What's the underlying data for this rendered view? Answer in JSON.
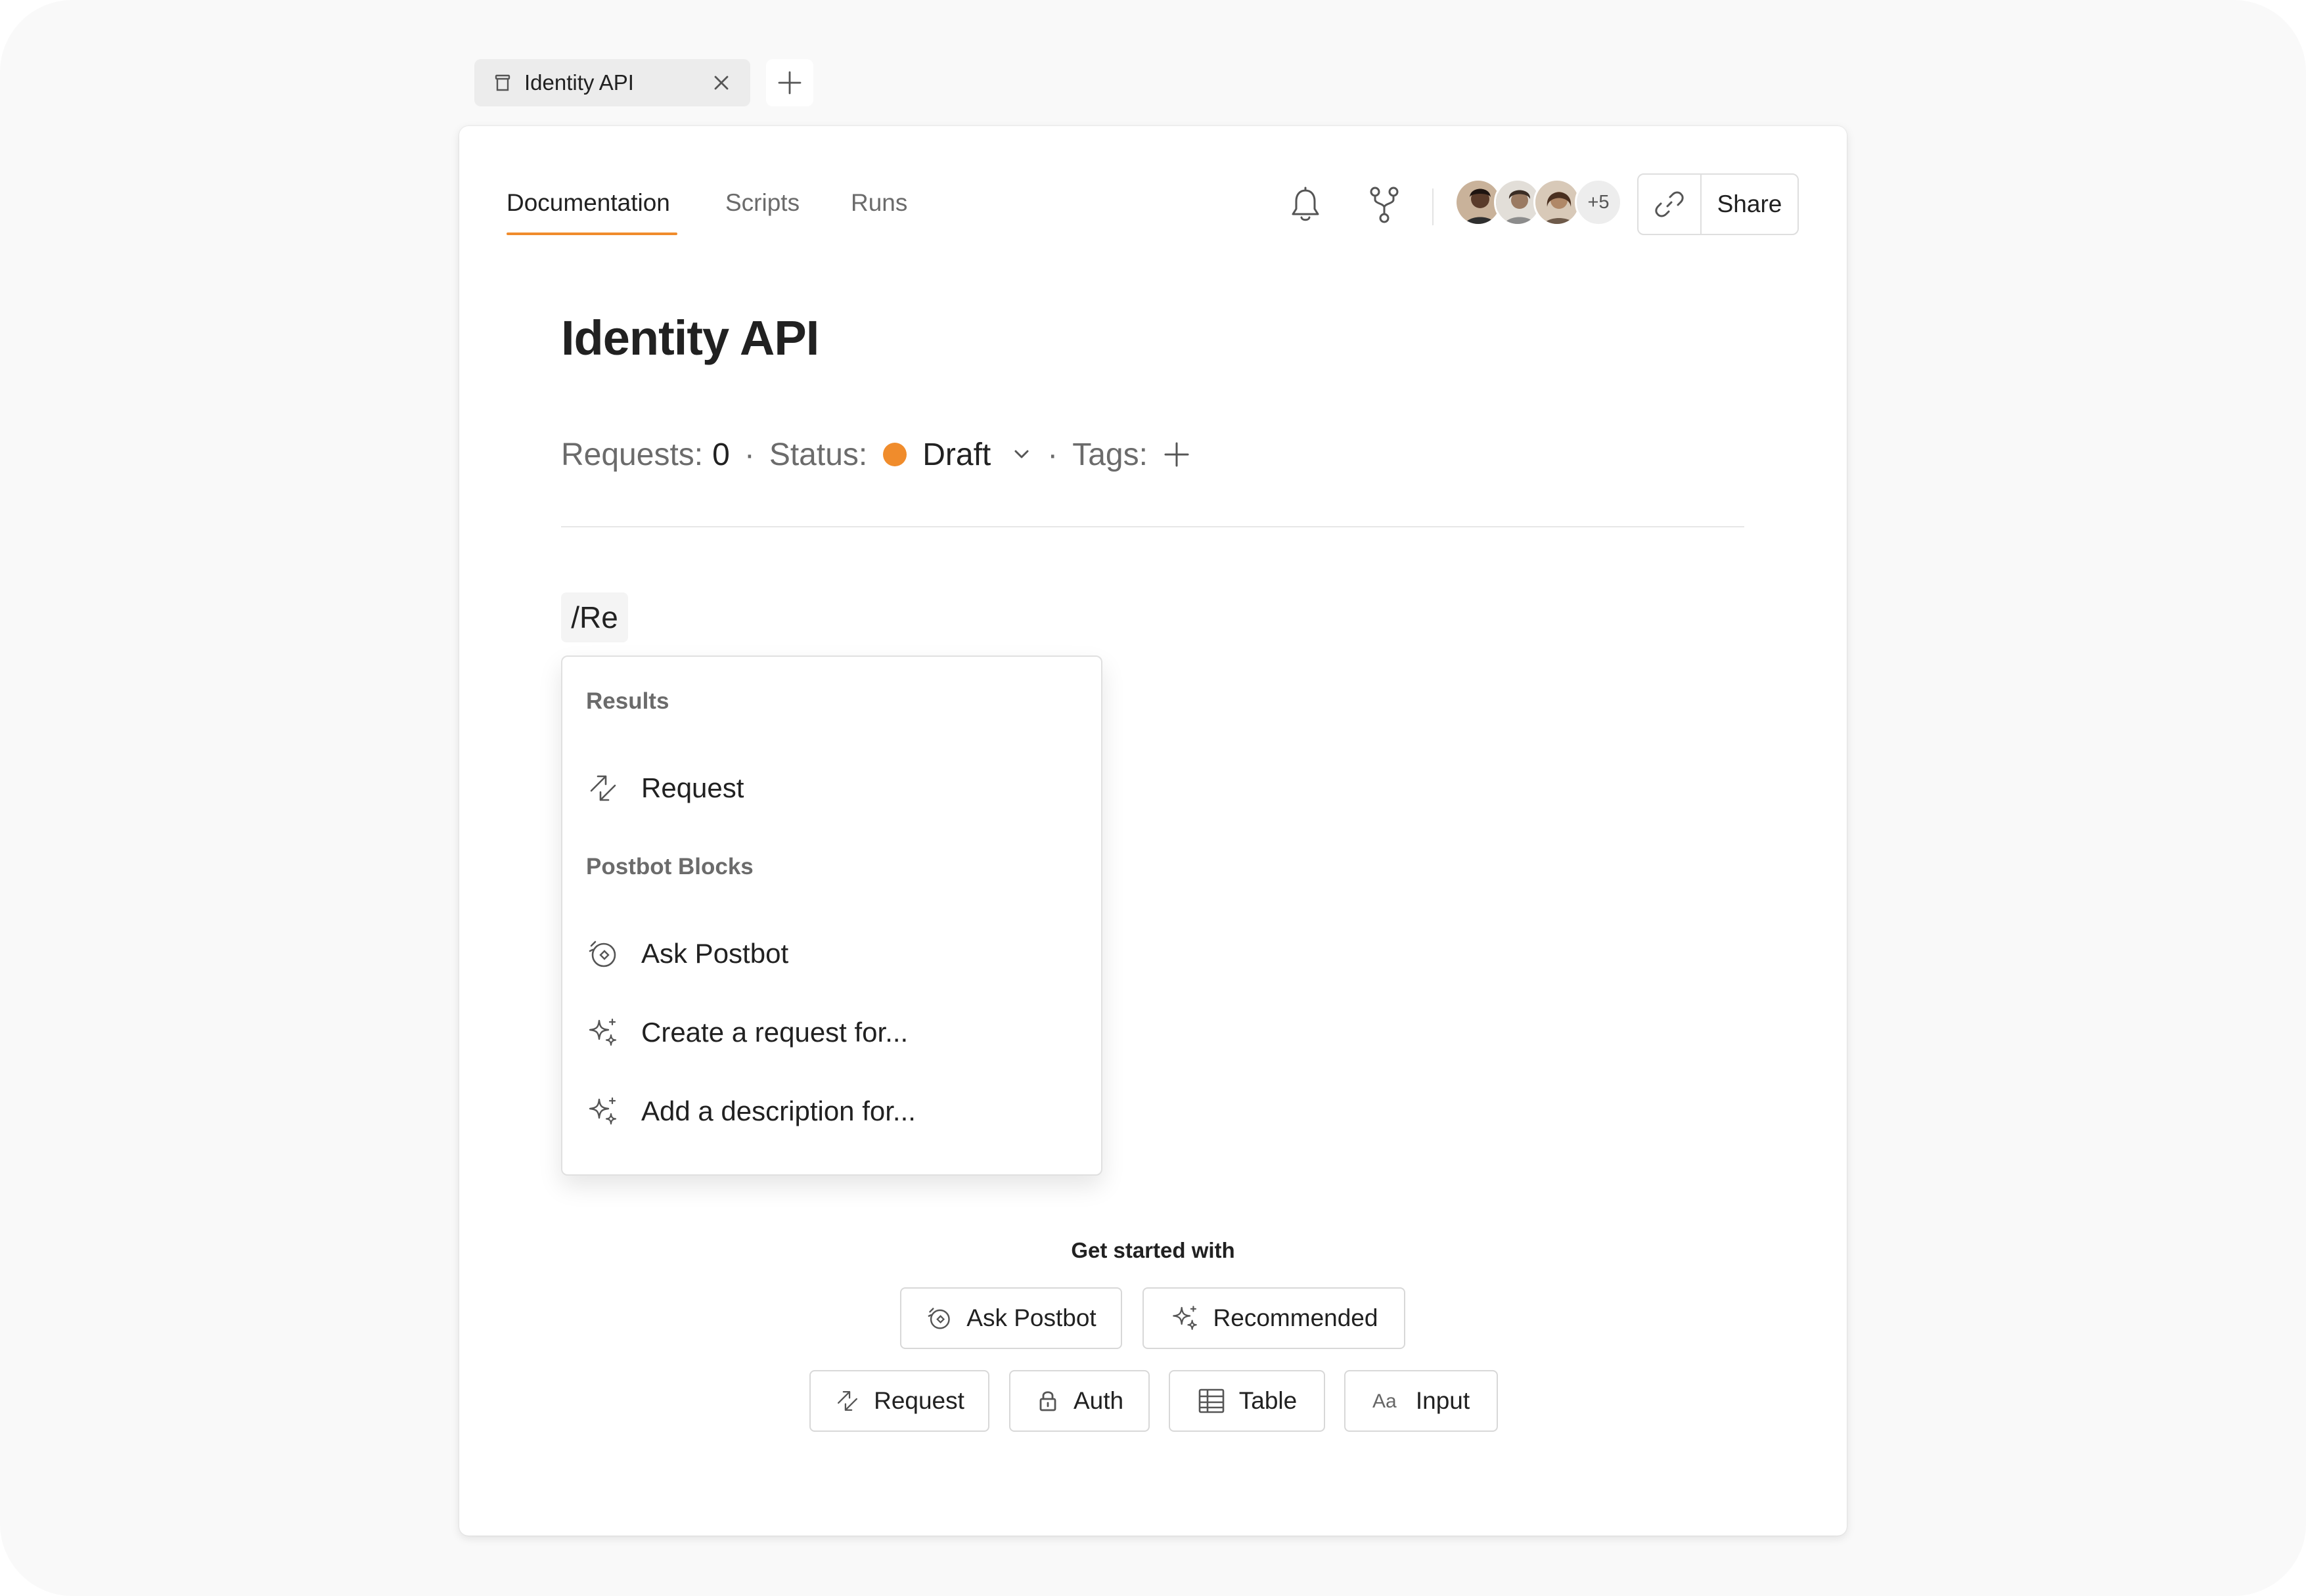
{
  "colors": {
    "accent": "#f08c2c",
    "text": "#212121",
    "muted": "#6b6b6b",
    "border": "#dedede"
  },
  "tab": {
    "label": "Identity API",
    "icon": "collection-icon"
  },
  "nav": {
    "tabs": [
      "Documentation",
      "Scripts",
      "Runs"
    ],
    "active": "Documentation"
  },
  "toolbar": {
    "avatars_more": "+5",
    "share_label": "Share"
  },
  "page": {
    "title": "Identity API",
    "requests_label": "Requests:",
    "requests_value": "0",
    "status_label": "Status:",
    "status_value": "Draft",
    "tags_label": "Tags:",
    "separator": "·"
  },
  "editor": {
    "input_text": "/Re"
  },
  "menu": {
    "results_header": "Results",
    "results_items": [
      {
        "label": "Request",
        "icon": "request-icon"
      }
    ],
    "postbot_header": "Postbot Blocks",
    "postbot_items": [
      {
        "label": "Ask Postbot",
        "icon": "postbot-icon"
      },
      {
        "label": "Create a request for...",
        "icon": "sparkles-icon"
      },
      {
        "label": "Add a description for...",
        "icon": "sparkles-icon"
      }
    ]
  },
  "get_started": {
    "heading": "Get started with",
    "row1": [
      {
        "label": "Ask Postbot",
        "icon": "postbot-icon"
      },
      {
        "label": "Recommended",
        "icon": "sparkles-icon"
      }
    ],
    "row2": [
      {
        "label": "Request",
        "icon": "request-icon"
      },
      {
        "label": "Auth",
        "icon": "lock-icon"
      },
      {
        "label": "Table",
        "icon": "table-icon"
      },
      {
        "label": "Input",
        "icon": "text-aa-icon"
      }
    ]
  }
}
